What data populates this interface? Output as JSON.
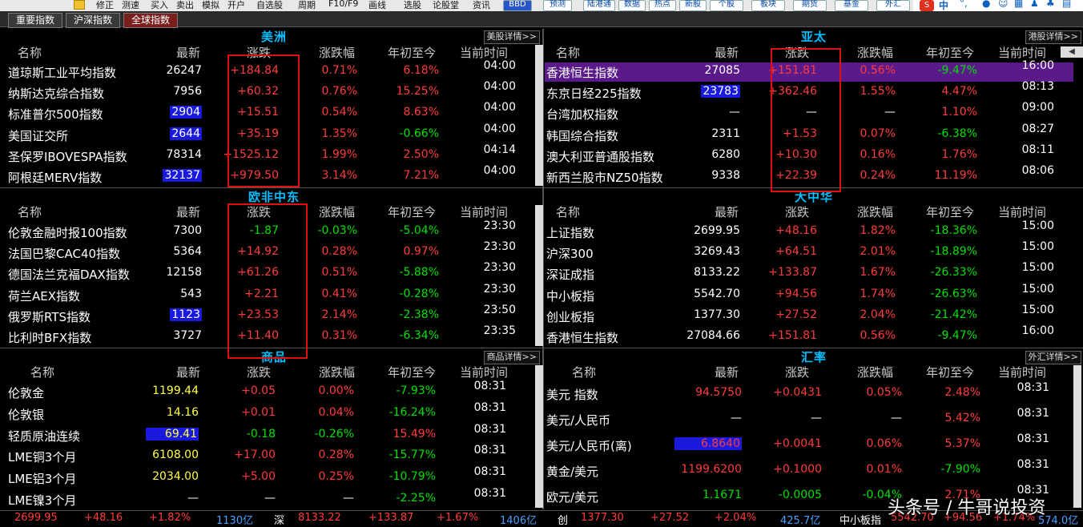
{
  "toolbar": {
    "items": [
      "修正",
      "测速",
      "买入",
      "卖出",
      "模拟",
      "开户",
      "自选股",
      "周期",
      "F10/F9",
      "画线",
      "选股",
      "论股堂",
      "资讯"
    ],
    "buttons": [
      "BBD",
      "预测",
      "陆港通",
      "数据",
      "热点",
      "新股",
      "个股",
      "板块",
      "期货",
      "基金",
      "外汇"
    ],
    "sogou_label": "中"
  },
  "tabs": [
    "重要指数",
    "沪深指数",
    "全球指数"
  ],
  "headers": [
    "名称",
    "最新",
    "涨跌",
    "涨跌幅",
    "年初至今",
    "当前时间"
  ],
  "panels": {
    "america": {
      "title": "美洲",
      "detail": "美股详情>>",
      "rows": [
        {
          "name": "道琼斯工业平均指数",
          "last": "26247",
          "chg": "+184.84",
          "pct": "0.71%",
          "ytd": "6.18%",
          "time": "04:00"
        },
        {
          "name": "纳斯达克综合指数",
          "last": "7956",
          "chg": "+60.32",
          "pct": "0.76%",
          "ytd": "15.25%",
          "time": "04:00"
        },
        {
          "name": "标准普尔500指数",
          "last": "2904",
          "chg": "+15.51",
          "pct": "0.54%",
          "ytd": "8.63%",
          "time": "04:00"
        },
        {
          "name": "美国证交所",
          "last": "2644",
          "chg": "+35.19",
          "pct": "1.35%",
          "ytd": "-0.66%",
          "time": "04:00"
        },
        {
          "name": "圣保罗IBOVESPA指数",
          "last": "78314",
          "chg": "+1525.12",
          "pct": "1.99%",
          "ytd": "2.50%",
          "time": "04:14"
        },
        {
          "name": "阿根廷MERV指数",
          "last": "32137",
          "chg": "+979.50",
          "pct": "3.14%",
          "ytd": "7.21%",
          "time": "04:00"
        }
      ]
    },
    "asia": {
      "title": "亚太",
      "detail": "港股详情>>",
      "rows": [
        {
          "name": "香港恒生指数",
          "last": "27085",
          "chg": "+151.81",
          "pct": "0.56%",
          "ytd": "-9.47%",
          "time": "16:00"
        },
        {
          "name": "东京日经225指数",
          "last": "23783",
          "chg": "+362.46",
          "pct": "1.55%",
          "ytd": "4.47%",
          "time": "08:13"
        },
        {
          "name": "台湾加权指数",
          "last": "—",
          "chg": "—",
          "pct": "—",
          "ytd": "1.10%",
          "time": "09:00"
        },
        {
          "name": "韩国综合指数",
          "last": "2311",
          "chg": "+1.53",
          "pct": "0.07%",
          "ytd": "-6.38%",
          "time": "08:27"
        },
        {
          "name": "澳大利亚普通股指数",
          "last": "6280",
          "chg": "+10.30",
          "pct": "0.16%",
          "ytd": "1.76%",
          "time": "08:11"
        },
        {
          "name": "新西兰股市NZ50指数",
          "last": "9338",
          "chg": "+22.39",
          "pct": "0.24%",
          "ytd": "11.19%",
          "time": "08:06"
        }
      ]
    },
    "europe": {
      "title": "欧非中东",
      "rows": [
        {
          "name": "伦敦金融时报100指数",
          "last": "7300",
          "chg": "-1.87",
          "pct": "-0.03%",
          "ytd": "-5.04%",
          "time": "23:30"
        },
        {
          "name": "法国巴黎CAC40指数",
          "last": "5364",
          "chg": "+14.92",
          "pct": "0.28%",
          "ytd": "0.97%",
          "time": "23:30"
        },
        {
          "name": "德国法兰克福DAX指数",
          "last": "12158",
          "chg": "+61.26",
          "pct": "0.51%",
          "ytd": "-5.88%",
          "time": "23:30"
        },
        {
          "name": "荷兰AEX指数",
          "last": "543",
          "chg": "+2.21",
          "pct": "0.41%",
          "ytd": "-0.28%",
          "time": "23:30"
        },
        {
          "name": "俄罗斯RTS指数",
          "last": "1123",
          "chg": "+23.53",
          "pct": "2.14%",
          "ytd": "-2.38%",
          "time": "23:50"
        },
        {
          "name": "比利时BFX指数",
          "last": "3727",
          "chg": "+11.40",
          "pct": "0.31%",
          "ytd": "-6.34%",
          "time": "23:35"
        }
      ]
    },
    "china": {
      "title": "大中华",
      "rows": [
        {
          "name": "上证指数",
          "last": "2699.95",
          "chg": "+48.16",
          "pct": "1.82%",
          "ytd": "-18.36%",
          "time": "15:00"
        },
        {
          "name": "沪深300",
          "last": "3269.43",
          "chg": "+64.51",
          "pct": "2.01%",
          "ytd": "-18.89%",
          "time": "15:00"
        },
        {
          "name": "深证成指",
          "last": "8133.22",
          "chg": "+133.87",
          "pct": "1.67%",
          "ytd": "-26.33%",
          "time": "15:00"
        },
        {
          "name": "中小板指",
          "last": "5542.70",
          "chg": "+94.56",
          "pct": "1.74%",
          "ytd": "-26.63%",
          "time": "15:00"
        },
        {
          "name": "创业板指",
          "last": "1377.30",
          "chg": "+27.52",
          "pct": "2.04%",
          "ytd": "-21.42%",
          "time": "15:00"
        },
        {
          "name": "香港恒生指数",
          "last": "27084.66",
          "chg": "+151.81",
          "pct": "0.56%",
          "ytd": "-9.47%",
          "time": "16:00"
        }
      ]
    },
    "commodity": {
      "title": "商品",
      "detail": "商品详情>>",
      "rows": [
        {
          "name": "伦敦金",
          "last": "1199.44",
          "chg": "+0.05",
          "pct": "0.00%",
          "ytd": "-7.93%",
          "time": "08:31"
        },
        {
          "name": "伦敦银",
          "last": "14.16",
          "chg": "+0.01",
          "pct": "0.04%",
          "ytd": "-16.24%",
          "time": "08:31"
        },
        {
          "name": "轻质原油连续",
          "last": "69.41",
          "chg": "-0.18",
          "pct": "-0.26%",
          "ytd": "15.49%",
          "time": "08:31"
        },
        {
          "name": "LME铜3个月",
          "last": "6108.00",
          "chg": "+17.00",
          "pct": "0.28%",
          "ytd": "-15.77%",
          "time": "08:31"
        },
        {
          "name": "LME铝3个月",
          "last": "2034.00",
          "chg": "+5.00",
          "pct": "0.25%",
          "ytd": "-10.79%",
          "time": "08:31"
        },
        {
          "name": "LME镍3个月",
          "last": "—",
          "chg": "—",
          "pct": "—",
          "ytd": "-2.25%",
          "time": "08:31"
        }
      ]
    },
    "fx": {
      "title": "汇率",
      "detail": "外汇详情>>",
      "rows": [
        {
          "name": "美元 指数",
          "last": "94.5750",
          "chg": "+0.0431",
          "pct": "0.05%",
          "ytd": "2.48%",
          "time": "08:31"
        },
        {
          "name": "美元/人民币",
          "last": "—",
          "chg": "—",
          "pct": "—",
          "ytd": "5.42%",
          "time": "08:31"
        },
        {
          "name": "美元/人民币(离)",
          "last": "6.8640",
          "chg": "+0.0041",
          "pct": "0.06%",
          "ytd": "5.37%",
          "time": "08:31"
        },
        {
          "name": "黄金/美元",
          "last": "1199.6200",
          "chg": "+0.1000",
          "pct": "0.01%",
          "ytd": "-7.90%",
          "time": "08:31"
        },
        {
          "name": "欧元/美元",
          "last": "1.1671",
          "chg": "-0.0005",
          "pct": "-0.04%",
          "ytd": "2.71%",
          "time": "08:31"
        }
      ]
    }
  },
  "status": {
    "sh_last": "2699.95",
    "sh_chg": "+48.16",
    "sh_pct": "+1.82%",
    "sh_vol": "1130亿",
    "sz_label": "深",
    "sz_last": "8133.22",
    "sz_chg": "+133.87",
    "sz_pct": "+1.67%",
    "sz_vol": "1406亿",
    "cy_label": "创",
    "cy_last": "1377.30",
    "cy_chg": "+27.52",
    "cy_pct": "+2.04%",
    "cy_vol": "425.7亿",
    "zx_label": "中小板指",
    "zx_last": "5542.70",
    "zx_chg": "+94.56",
    "zx_pct": "+1.74%",
    "zx_vol": "574.0亿"
  },
  "watermark": "头条号 / 牛哥说投资"
}
